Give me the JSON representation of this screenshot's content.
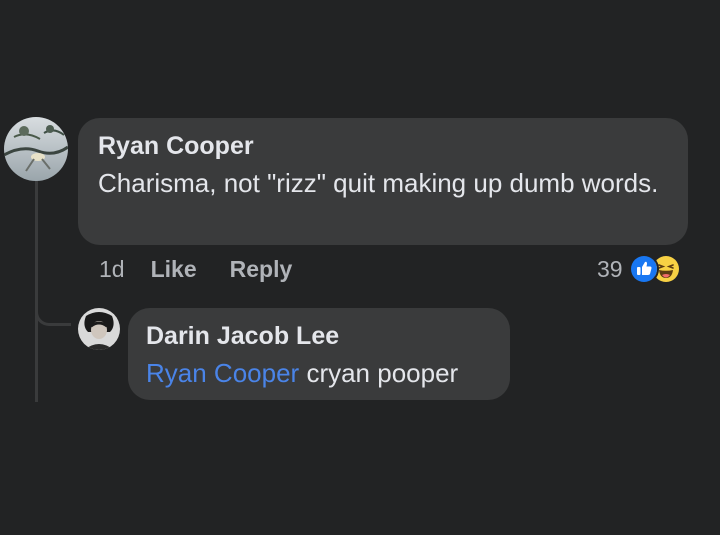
{
  "colors": {
    "background": "#222324",
    "bubble": "#3a3b3c",
    "text": "#e4e6eb",
    "secondary_text": "#b0b3b8",
    "mention": "#4a84e8",
    "like_blue": "#1877f2",
    "haha_yellow": "#f7d144"
  },
  "comment": {
    "author": "Ryan Cooper",
    "text": "Charisma, not \"rizz\" quit making up dumb words.",
    "timestamp": "1d",
    "like_label": "Like",
    "reply_label": "Reply",
    "reaction_count": "39",
    "reaction_icons": [
      "like-icon",
      "haha-icon"
    ]
  },
  "reply": {
    "author": "Darin Jacob Lee",
    "mention": "Ryan Cooper",
    "text": "cryan pooper"
  }
}
